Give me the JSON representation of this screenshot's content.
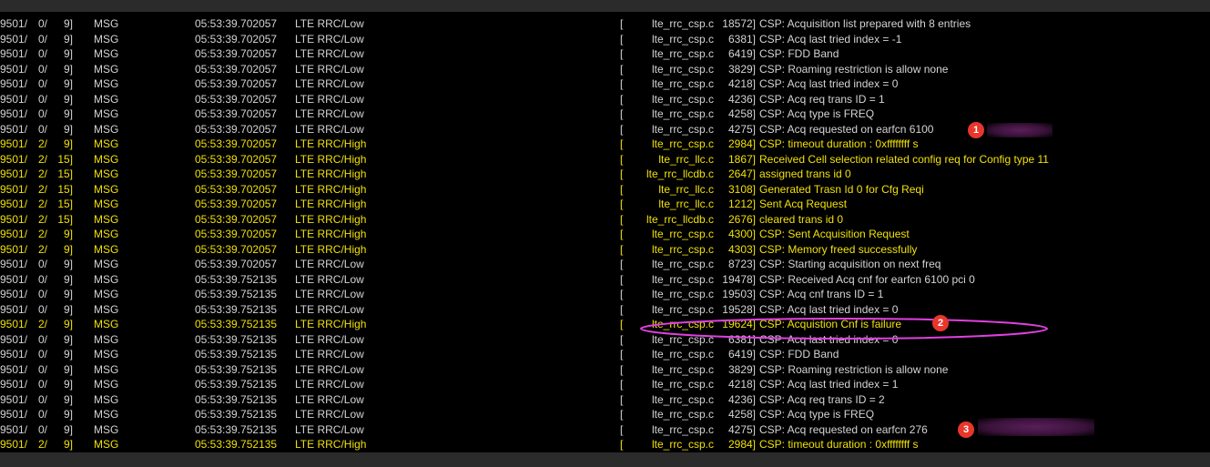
{
  "colors": {
    "low": "#d4d4d4",
    "high": "#f0e00a",
    "ellipse": "#e040e0",
    "marker": "#e8362b",
    "redact": "#4a1a4a"
  },
  "rows": [
    {
      "num": "9501/",
      "sub": "0/",
      "ln": "9]",
      "type": "MSG",
      "time": "05:53:39.702057",
      "cat": "LTE RRC/Low",
      "br": "[",
      "file": "lte_rrc_csp.c",
      "code": "18572]",
      "msg": "CSP: Acquisition list prepared with 8 entries",
      "level": "low"
    },
    {
      "num": "9501/",
      "sub": "0/",
      "ln": "9]",
      "type": "MSG",
      "time": "05:53:39.702057",
      "cat": "LTE RRC/Low",
      "br": "[",
      "file": "lte_rrc_csp.c",
      "code": "6381]",
      "msg": "CSP: Acq last tried index = -1",
      "level": "low"
    },
    {
      "num": "9501/",
      "sub": "0/",
      "ln": "9]",
      "type": "MSG",
      "time": "05:53:39.702057",
      "cat": "LTE RRC/Low",
      "br": "[",
      "file": "lte_rrc_csp.c",
      "code": "6419]",
      "msg": "CSP: FDD Band",
      "level": "low"
    },
    {
      "num": "9501/",
      "sub": "0/",
      "ln": "9]",
      "type": "MSG",
      "time": "05:53:39.702057",
      "cat": "LTE RRC/Low",
      "br": "[",
      "file": "lte_rrc_csp.c",
      "code": "3829]",
      "msg": "CSP: Roaming restriction is allow none",
      "level": "low"
    },
    {
      "num": "9501/",
      "sub": "0/",
      "ln": "9]",
      "type": "MSG",
      "time": "05:53:39.702057",
      "cat": "LTE RRC/Low",
      "br": "[",
      "file": "lte_rrc_csp.c",
      "code": "4218]",
      "msg": "CSP: Acq last tried index = 0",
      "level": "low"
    },
    {
      "num": "9501/",
      "sub": "0/",
      "ln": "9]",
      "type": "MSG",
      "time": "05:53:39.702057",
      "cat": "LTE RRC/Low",
      "br": "[",
      "file": "lte_rrc_csp.c",
      "code": "4236]",
      "msg": "CSP: Acq req trans ID = 1",
      "level": "low"
    },
    {
      "num": "9501/",
      "sub": "0/",
      "ln": "9]",
      "type": "MSG",
      "time": "05:53:39.702057",
      "cat": "LTE RRC/Low",
      "br": "[",
      "file": "lte_rrc_csp.c",
      "code": "4258]",
      "msg": "CSP: Acq type is FREQ",
      "level": "low"
    },
    {
      "num": "9501/",
      "sub": "0/",
      "ln": "9]",
      "type": "MSG",
      "time": "05:53:39.702057",
      "cat": "LTE RRC/Low",
      "br": "[",
      "file": "lte_rrc_csp.c",
      "code": "4275]",
      "msg": "CSP: Acq requested on earfcn 6100",
      "level": "low"
    },
    {
      "num": "9501/",
      "sub": "2/",
      "ln": "9]",
      "type": "MSG",
      "time": "05:53:39.702057",
      "cat": "LTE RRC/High",
      "br": "[",
      "file": "lte_rrc_csp.c",
      "code": "2984]",
      "msg": "CSP: timeout duration : 0xffffffff s",
      "level": "high"
    },
    {
      "num": "9501/",
      "sub": "2/",
      "ln": "15]",
      "type": "MSG",
      "time": "05:53:39.702057",
      "cat": "LTE RRC/High",
      "br": "[",
      "file": "lte_rrc_llc.c",
      "code": "1867]",
      "msg": "Received Cell selection related config req for Config type 11",
      "level": "high"
    },
    {
      "num": "9501/",
      "sub": "2/",
      "ln": "15]",
      "type": "MSG",
      "time": "05:53:39.702057",
      "cat": "LTE RRC/High",
      "br": "[",
      "file": "lte_rrc_llcdb.c",
      "code": "2647]",
      "msg": "assigned trans id 0",
      "level": "high"
    },
    {
      "num": "9501/",
      "sub": "2/",
      "ln": "15]",
      "type": "MSG",
      "time": "05:53:39.702057",
      "cat": "LTE RRC/High",
      "br": "[",
      "file": "lte_rrc_llc.c",
      "code": "3108]",
      "msg": "Generated Trasn Id 0 for Cfg Reqi",
      "level": "high"
    },
    {
      "num": "9501/",
      "sub": "2/",
      "ln": "15]",
      "type": "MSG",
      "time": "05:53:39.702057",
      "cat": "LTE RRC/High",
      "br": "[",
      "file": "lte_rrc_llc.c",
      "code": "1212]",
      "msg": "Sent Acq Request",
      "level": "high"
    },
    {
      "num": "9501/",
      "sub": "2/",
      "ln": "15]",
      "type": "MSG",
      "time": "05:53:39.702057",
      "cat": "LTE RRC/High",
      "br": "[",
      "file": "lte_rrc_llcdb.c",
      "code": "2676]",
      "msg": "cleared trans id 0",
      "level": "high"
    },
    {
      "num": "9501/",
      "sub": "2/",
      "ln": "9]",
      "type": "MSG",
      "time": "05:53:39.702057",
      "cat": "LTE RRC/High",
      "br": "[",
      "file": "lte_rrc_csp.c",
      "code": "4300]",
      "msg": "CSP: Sent Acquisition Request",
      "level": "high"
    },
    {
      "num": "9501/",
      "sub": "2/",
      "ln": "9]",
      "type": "MSG",
      "time": "05:53:39.702057",
      "cat": "LTE RRC/High",
      "br": "[",
      "file": "lte_rrc_csp.c",
      "code": "4303]",
      "msg": "CSP: Memory freed successfully",
      "level": "high"
    },
    {
      "num": "9501/",
      "sub": "0/",
      "ln": "9]",
      "type": "MSG",
      "time": "05:53:39.702057",
      "cat": "LTE RRC/Low",
      "br": "[",
      "file": "lte_rrc_csp.c",
      "code": "8723]",
      "msg": "CSP: Starting acquisition on next freq",
      "level": "low"
    },
    {
      "num": "9501/",
      "sub": "0/",
      "ln": "9]",
      "type": "MSG",
      "time": "05:53:39.752135",
      "cat": "LTE RRC/Low",
      "br": "[",
      "file": "lte_rrc_csp.c",
      "code": "19478]",
      "msg": "CSP: Received Acq cnf for earfcn 6100 pci 0",
      "level": "low"
    },
    {
      "num": "9501/",
      "sub": "0/",
      "ln": "9]",
      "type": "MSG",
      "time": "05:53:39.752135",
      "cat": "LTE RRC/Low",
      "br": "[",
      "file": "lte_rrc_csp.c",
      "code": "19503]",
      "msg": "CSP: Acq cnf trans ID = 1",
      "level": "low"
    },
    {
      "num": "9501/",
      "sub": "0/",
      "ln": "9]",
      "type": "MSG",
      "time": "05:53:39.752135",
      "cat": "LTE RRC/Low",
      "br": "[",
      "file": "lte_rrc_csp.c",
      "code": "19528]",
      "msg": "CSP: Acq last tried index = 0",
      "level": "low"
    },
    {
      "num": "9501/",
      "sub": "2/",
      "ln": "9]",
      "type": "MSG",
      "time": "05:53:39.752135",
      "cat": "LTE RRC/High",
      "br": "[",
      "file": "lte_rrc_csp.c",
      "code": "19624]",
      "msg": "CSP: Acquistion Cnf is failure",
      "level": "high"
    },
    {
      "num": "9501/",
      "sub": "0/",
      "ln": "9]",
      "type": "MSG",
      "time": "05:53:39.752135",
      "cat": "LTE RRC/Low",
      "br": "[",
      "file": "lte_rrc_csp.c",
      "code": "6381]",
      "msg": "CSP: Acq last tried index = 0",
      "level": "low"
    },
    {
      "num": "9501/",
      "sub": "0/",
      "ln": "9]",
      "type": "MSG",
      "time": "05:53:39.752135",
      "cat": "LTE RRC/Low",
      "br": "[",
      "file": "lte_rrc_csp.c",
      "code": "6419]",
      "msg": "CSP: FDD Band",
      "level": "low"
    },
    {
      "num": "9501/",
      "sub": "0/",
      "ln": "9]",
      "type": "MSG",
      "time": "05:53:39.752135",
      "cat": "LTE RRC/Low",
      "br": "[",
      "file": "lte_rrc_csp.c",
      "code": "3829]",
      "msg": "CSP: Roaming restriction is allow none",
      "level": "low"
    },
    {
      "num": "9501/",
      "sub": "0/",
      "ln": "9]",
      "type": "MSG",
      "time": "05:53:39.752135",
      "cat": "LTE RRC/Low",
      "br": "[",
      "file": "lte_rrc_csp.c",
      "code": "4218]",
      "msg": "CSP: Acq last tried index = 1",
      "level": "low"
    },
    {
      "num": "9501/",
      "sub": "0/",
      "ln": "9]",
      "type": "MSG",
      "time": "05:53:39.752135",
      "cat": "LTE RRC/Low",
      "br": "[",
      "file": "lte_rrc_csp.c",
      "code": "4236]",
      "msg": "CSP: Acq req trans ID = 2",
      "level": "low"
    },
    {
      "num": "9501/",
      "sub": "0/",
      "ln": "9]",
      "type": "MSG",
      "time": "05:53:39.752135",
      "cat": "LTE RRC/Low",
      "br": "[",
      "file": "lte_rrc_csp.c",
      "code": "4258]",
      "msg": "CSP: Acq type is FREQ",
      "level": "low"
    },
    {
      "num": "9501/",
      "sub": "0/",
      "ln": "9]",
      "type": "MSG",
      "time": "05:53:39.752135",
      "cat": "LTE RRC/Low",
      "br": "[",
      "file": "lte_rrc_csp.c",
      "code": "4275]",
      "msg": "CSP: Acq requested on earfcn 276",
      "level": "low"
    },
    {
      "num": "9501/",
      "sub": "2/",
      "ln": "9]",
      "type": "MSG",
      "time": "05:53:39.752135",
      "cat": "LTE RRC/High",
      "br": "[",
      "file": "lte_rrc_csp.c",
      "code": "2984]",
      "msg": "CSP: timeout duration : 0xffffffff s",
      "level": "high"
    }
  ],
  "markers": [
    {
      "label": "1",
      "row": 7
    },
    {
      "label": "2",
      "row": 20
    },
    {
      "label": "3",
      "row": 27
    }
  ]
}
